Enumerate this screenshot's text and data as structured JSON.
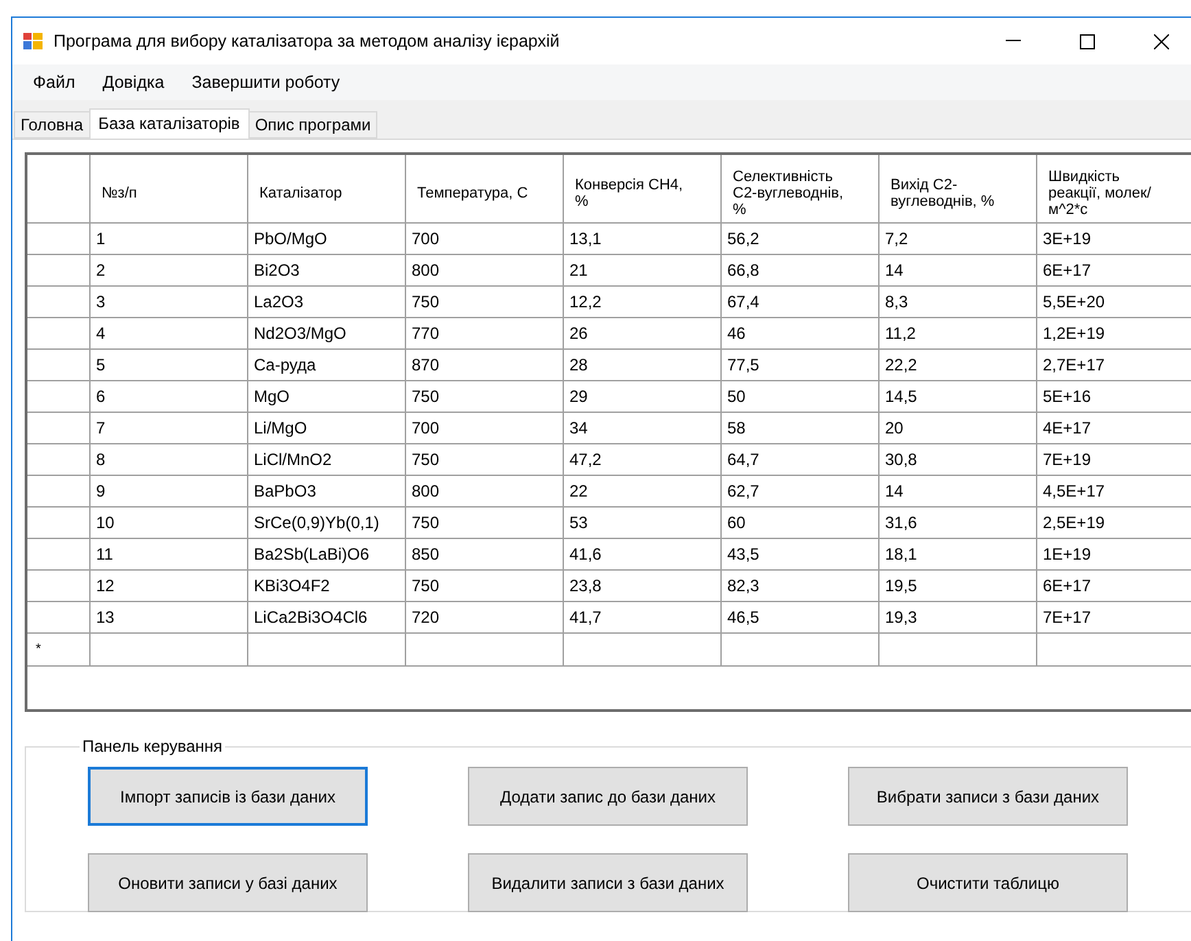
{
  "window": {
    "title": "Програма для вибору каталізатора за методом аналізу ієрархій"
  },
  "menu": [
    "Файл",
    "Довідка",
    "Завершити роботу"
  ],
  "tabs": [
    {
      "label": "Головна",
      "selected": false
    },
    {
      "label": "База каталізаторів",
      "selected": true
    },
    {
      "label": "Опис програми",
      "selected": false
    }
  ],
  "table": {
    "columns": [
      "№з/п",
      "Каталізатор",
      "Температура, С",
      "Конверсія CH4, %",
      "Селективність С2-вуглеводнів, %",
      "Вихід С2-вуглеводнів, %",
      "Швидкість реакції, молек/м^2*с"
    ],
    "rows": [
      [
        "1",
        "PbO/MgO",
        "700",
        "13,1",
        "56,2",
        "7,2",
        "3E+19"
      ],
      [
        "2",
        "Bi2O3",
        "800",
        "21",
        "66,8",
        "14",
        "6E+17"
      ],
      [
        "3",
        "La2O3",
        "750",
        "12,2",
        "67,4",
        "8,3",
        "5,5E+20"
      ],
      [
        "4",
        "Nd2O3/MgO",
        "770",
        "26",
        "46",
        "11,2",
        "1,2E+19"
      ],
      [
        "5",
        "Ca-руда",
        "870",
        "28",
        "77,5",
        "22,2",
        "2,7E+17"
      ],
      [
        "6",
        "MgO",
        "750",
        "29",
        "50",
        "14,5",
        "5E+16"
      ],
      [
        "7",
        "Li/MgO",
        "700",
        "34",
        "58",
        "20",
        "4E+17"
      ],
      [
        "8",
        "LiCl/MnO2",
        "750",
        "47,2",
        "64,7",
        "30,8",
        "7E+19"
      ],
      [
        "9",
        "BaPbO3",
        "800",
        "22",
        "62,7",
        "14",
        "4,5E+17"
      ],
      [
        "10",
        "SrCe(0,9)Yb(0,1)",
        "750",
        "53",
        "60",
        "31,6",
        "2,5E+19"
      ],
      [
        "11",
        "Ba2Sb(LaBi)O6",
        "850",
        "41,6",
        "43,5",
        "18,1",
        "1E+19"
      ],
      [
        "12",
        "KBi3O4F2",
        "750",
        "23,8",
        "82,3",
        "19,5",
        "6E+17"
      ],
      [
        "13",
        "LiCa2Bi3O4Cl6",
        "720",
        "41,7",
        "46,5",
        "19,3",
        "7E+17"
      ]
    ],
    "new_row_marker": "*"
  },
  "control_panel": {
    "title": "Панель керування",
    "buttons": [
      {
        "label": "Імпорт записів із бази даних",
        "focused": true
      },
      {
        "label": "Додати запис до бази даних",
        "focused": false
      },
      {
        "label": "Вибрати записи з бази даних",
        "focused": false
      },
      {
        "label": "Оновити записи у базі даних",
        "focused": false
      },
      {
        "label": "Видалити записи з бази даних",
        "focused": false
      },
      {
        "label": "Очистити таблицю",
        "focused": false
      }
    ]
  }
}
